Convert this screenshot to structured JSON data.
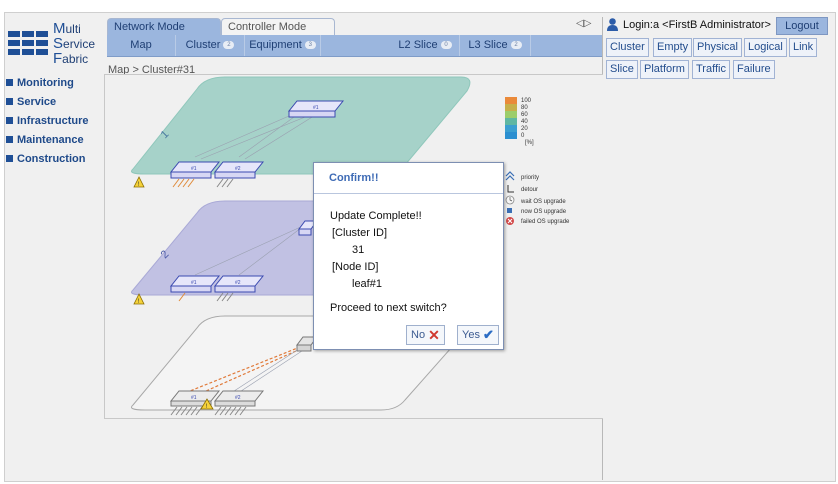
{
  "logo": {
    "line1_initial": "M",
    "line1_rest": "ulti",
    "line2_initial": "S",
    "line2_rest": "ervice",
    "line3_initial": "F",
    "line3_rest": "abric"
  },
  "nav": [
    {
      "label": "Monitoring"
    },
    {
      "label": "Service"
    },
    {
      "label": "Infrastructure"
    },
    {
      "label": "Maintenance"
    },
    {
      "label": "Construction"
    }
  ],
  "modes": {
    "network": "Network Mode",
    "controller": "Controller Mode"
  },
  "subtabs": [
    {
      "label": "Map",
      "badge": ""
    },
    {
      "label": "Cluster",
      "badge": "2"
    },
    {
      "label": "Equipment",
      "badge": "3"
    },
    {
      "label": "L2 Slice",
      "badge": "0"
    },
    {
      "label": "L3 Slice",
      "badge": "2"
    }
  ],
  "breadcrumb": "Map > Cluster#31",
  "map": {
    "cluster_labels": [
      "1",
      "2"
    ],
    "node_labels": [
      "#1",
      "#2"
    ],
    "spine_label": "#1"
  },
  "legend": {
    "scale": [
      "100",
      "80",
      "60",
      "40",
      "20",
      "0"
    ],
    "unit": "[%]",
    "items": [
      {
        "label": "priority"
      },
      {
        "label": "detour"
      },
      {
        "label": "wait OS upgrade"
      },
      {
        "label": "now OS upgrade"
      },
      {
        "label": "failed OS upgrade"
      }
    ],
    "colors": {
      "high": "#f08a1f",
      "mid": "#9ccd6a",
      "low": "#2b8fd0"
    }
  },
  "header": {
    "play_toggle": "◁▷",
    "login_text": "Login:a <FirstB Administrator>",
    "logout": "Logout"
  },
  "right_buttons": {
    "row1": [
      "Cluster",
      "Empty",
      "Physical",
      "Logical",
      "Link"
    ],
    "row2": [
      "Slice",
      "Platform",
      "Traffic",
      "Failure"
    ]
  },
  "dialog": {
    "title": "Confirm!!",
    "line1": "Update Complete!!",
    "cluster_heading": "[Cluster ID]",
    "cluster_value": "31",
    "node_heading": "[Node ID]",
    "node_value": "leaf#1",
    "question": "Proceed to next switch?",
    "no": "No",
    "yes": "Yes"
  }
}
